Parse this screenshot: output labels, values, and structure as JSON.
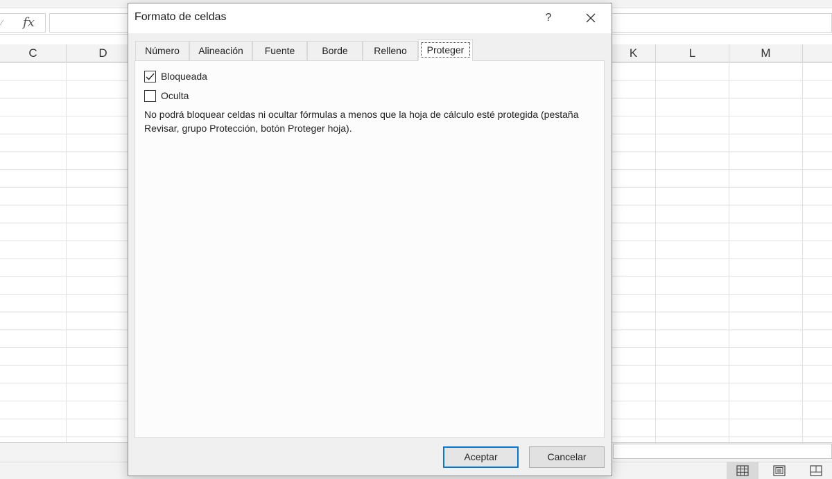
{
  "excel": {
    "fx_label": "fx",
    "columns": [
      "C",
      "D",
      "K",
      "L",
      "M"
    ]
  },
  "dialog": {
    "title": "Formato de celdas",
    "help_label": "?",
    "tabs": [
      {
        "label": "Número",
        "active": false
      },
      {
        "label": "Alineación",
        "active": false
      },
      {
        "label": "Fuente",
        "active": false
      },
      {
        "label": "Borde",
        "active": false
      },
      {
        "label": "Relleno",
        "active": false
      },
      {
        "label": "Proteger",
        "active": true
      }
    ],
    "options": {
      "locked": {
        "label": "Bloqueada",
        "checked": true
      },
      "hidden": {
        "label": "Oculta",
        "checked": false
      }
    },
    "note": "No podrá bloquear celdas ni ocultar fórmulas a menos que la hoja de cálculo esté protegida (pestaña Revisar, grupo Protección, botón Proteger hoja).",
    "buttons": {
      "ok": "Aceptar",
      "cancel": "Cancelar"
    }
  },
  "colors": {
    "accent": "#0078d7",
    "dialog_bg": "#f0f0f0",
    "panel_bg": "#fcfcfc"
  },
  "icons": [
    "fx-icon",
    "close-icon",
    "checkmark-icon",
    "normal-view-icon",
    "page-layout-icon",
    "page-break-preview-icon"
  ]
}
